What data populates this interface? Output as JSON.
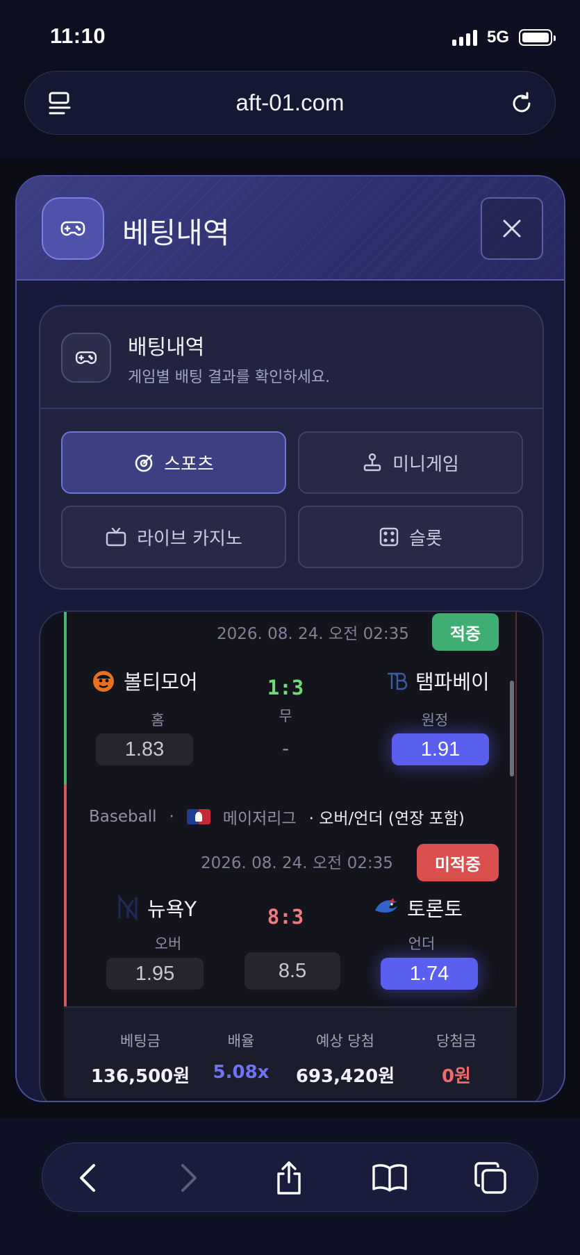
{
  "status_bar": {
    "time": "11:10",
    "network": "5G"
  },
  "browser": {
    "url": "aft-01.com"
  },
  "modal": {
    "title": "베팅내역",
    "close_icon": "close-icon"
  },
  "filter": {
    "title": "배팅내역",
    "subtitle": "게임별 배팅 결과를 확인하세요.",
    "tabs": [
      {
        "label": "스포츠",
        "icon": "sports-icon",
        "active": true
      },
      {
        "label": "미니게임",
        "icon": "joystick-icon",
        "active": false
      },
      {
        "label": "라이브 카지노",
        "icon": "tv-icon",
        "active": false
      },
      {
        "label": "슬롯",
        "icon": "dice-icon",
        "active": false
      }
    ]
  },
  "bet": {
    "matches": [
      {
        "date": "2026. 08. 24. 오전 02:35",
        "result": "적중",
        "home_team": "볼티모어",
        "away_team": "탬파베이",
        "score": "1:3",
        "home_label": "홈",
        "draw_label": "무",
        "away_label": "원정",
        "home_odd": "1.83",
        "draw_odd": "-",
        "away_odd": "1.91",
        "selected": "away"
      },
      {
        "sport": "Baseball",
        "league": "메이저리그",
        "market": "· 오버/언더 (연장 포함)",
        "date": "2026. 08. 24. 오전 02:35",
        "result": "미적중",
        "home_team": "뉴욕Y",
        "away_team": "토론토",
        "score": "8:3",
        "home_label": "오버",
        "away_label": "언더",
        "home_odd": "1.95",
        "line": "8.5",
        "away_odd": "1.74",
        "selected": "away"
      }
    ],
    "summary": {
      "stake_label": "베팅금",
      "stake": "136,500원",
      "odds_label": "배율",
      "odds": "5.08x",
      "expected_label": "예상 당첨",
      "expected": "693,420원",
      "payout_label": "당첨금",
      "payout": "0원"
    }
  },
  "colors": {
    "accent": "#5b5ff0",
    "win": "#3fae72",
    "lose": "#db4e4e",
    "score_win": "#6fdc7a",
    "score_lose": "#ef7b7b"
  }
}
